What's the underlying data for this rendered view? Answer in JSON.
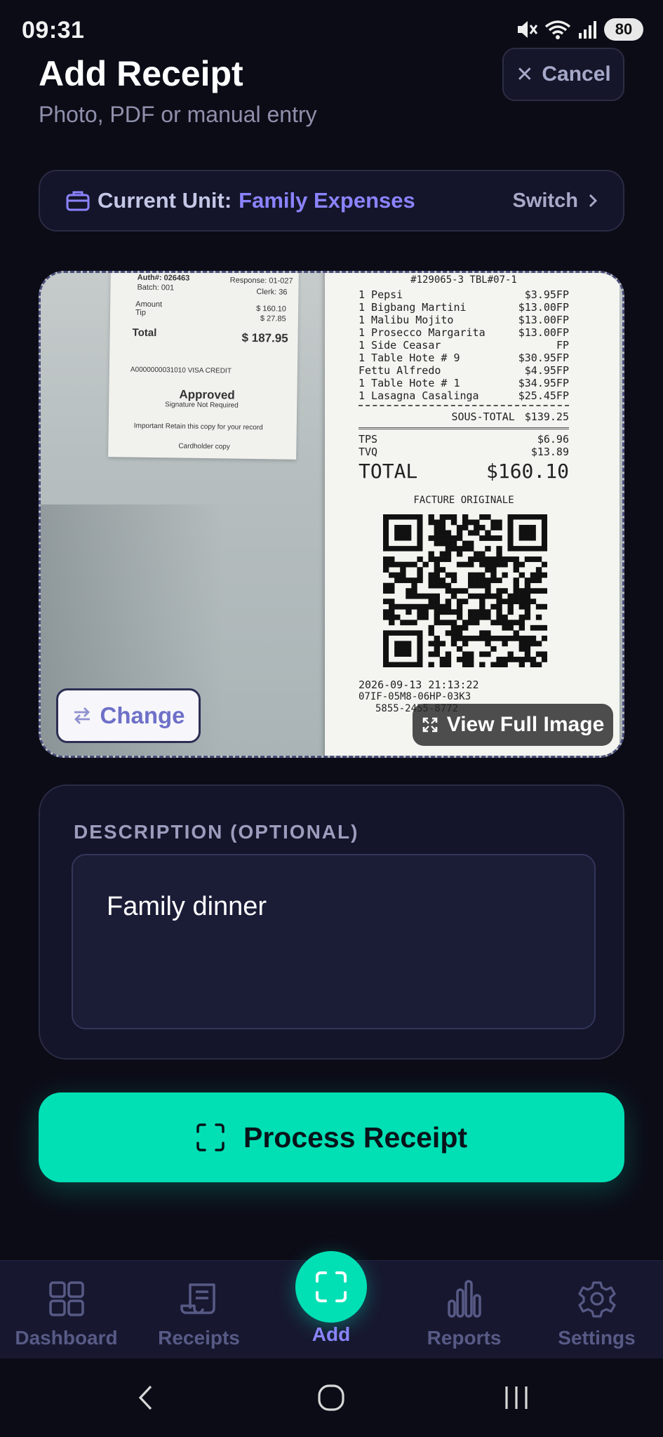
{
  "status_bar": {
    "time": "09:31",
    "battery": "80"
  },
  "header": {
    "title": "Add Receipt",
    "subtitle": "Photo, PDF or manual entry",
    "cancel_label": "Cancel"
  },
  "unit": {
    "label": "Current Unit:",
    "value": "Family Expenses",
    "switch_label": "Switch"
  },
  "preview": {
    "change_label": "Change",
    "view_full_label": "View Full Image",
    "receipt_left": {
      "auth": "Auth#: 026463",
      "response": "Response: 01-027",
      "batch": "Batch: 001",
      "clerk": "Clerk: 36",
      "amount_label": "Amount",
      "amount": "$ 160.10",
      "tip_label": "Tip",
      "tip": "$ 27.85",
      "total_label": "Total",
      "total": "$ 187.95",
      "card": "A0000000031010 VISA CREDIT",
      "approved": "Approved",
      "signature": "Signature Not Required",
      "retain": "Important Retain this copy for your record",
      "cardholder": "Cardholder copy"
    },
    "receipt_right": {
      "header": "#129065-3 TBL#07-1",
      "items": [
        {
          "name": "1 Pepsi",
          "price": "$3.95FP"
        },
        {
          "name": "1 Bigbang Martini",
          "price": "$13.00FP"
        },
        {
          "name": "1 Malibu Mojito",
          "price": "$13.00FP"
        },
        {
          "name": "1 Prosecco Margarita",
          "price": "$13.00FP"
        },
        {
          "name": "1 Side Ceasar",
          "price": "FP"
        },
        {
          "name": "1 Table Hote # 9",
          "price": "$30.95FP"
        },
        {
          "name": "  Fettu Alfredo",
          "price": "$4.95FP"
        },
        {
          "name": "1 Table Hote # 1",
          "price": "$34.95FP"
        },
        {
          "name": "1 Lasagna Casalinga",
          "price": "$25.45FP"
        }
      ],
      "subtotal_label": "SOUS-TOTAL",
      "subtotal": "$139.25",
      "tps_label": "TPS",
      "tps": "$6.96",
      "tvq_label": "TVQ",
      "tvq": "$13.89",
      "total_label": "TOTAL",
      "total": "$160.10",
      "facture": "FACTURE ORIGINALE",
      "datetime": "2026-09-13 21:13:22",
      "code1": "07IF-05M8-06HP-03K3",
      "code2": "5855-2455-8772"
    }
  },
  "description": {
    "label": "DESCRIPTION (OPTIONAL)",
    "value": "Family dinner"
  },
  "process_label": "Process Receipt",
  "nav": {
    "items": [
      {
        "label": "Dashboard",
        "icon": "grid-icon"
      },
      {
        "label": "Receipts",
        "icon": "receipt-icon"
      },
      {
        "label": "Add",
        "icon": "scan-icon"
      },
      {
        "label": "Reports",
        "icon": "bar-chart-icon"
      },
      {
        "label": "Settings",
        "icon": "gear-icon"
      }
    ]
  },
  "colors": {
    "background": "#0c0c17",
    "accent": "#00e0b4",
    "accent_purple": "#8b83ff",
    "card": "#14152a"
  }
}
